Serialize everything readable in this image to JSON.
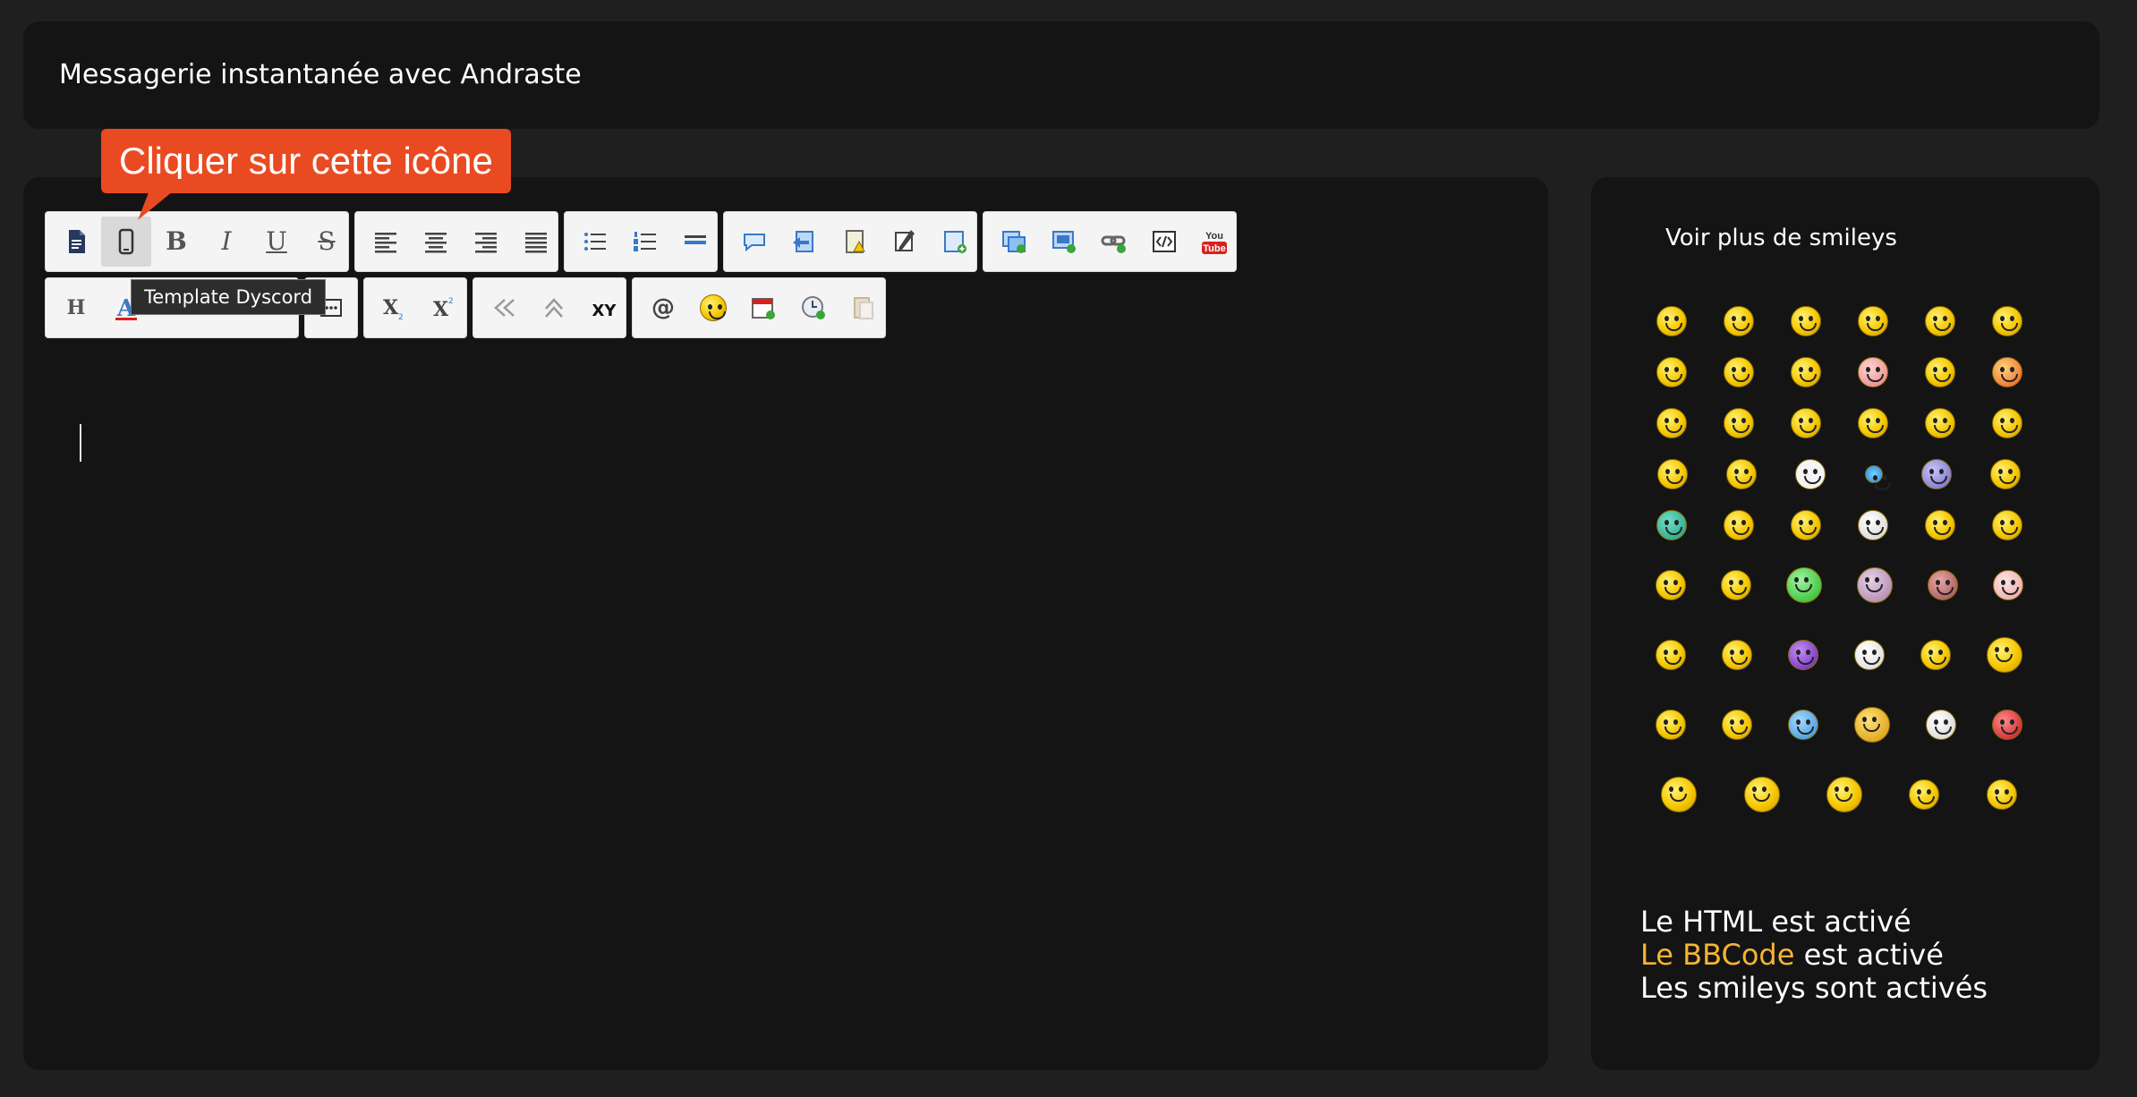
{
  "header": {
    "title": "Messagerie instantanée avec Andraste"
  },
  "callout": {
    "text": "Cliquer sur cette icône"
  },
  "tooltip": {
    "text": "Template Dyscord"
  },
  "toolbar": {
    "row1": [
      [
        "document-icon",
        "template-dyscord-icon",
        "bold-icon",
        "italic-icon",
        "underline-icon",
        "strikethrough-icon"
      ],
      [
        "align-left-icon",
        "align-center-icon",
        "align-right-icon",
        "align-justify-icon"
      ],
      [
        "bullet-list-icon",
        "numbered-list-icon",
        "horizontal-rule-icon"
      ],
      [
        "quote-icon",
        "spoiler-icon",
        "hide-icon",
        "edit-icon",
        "table-insert-icon"
      ],
      [
        "image-insert-icon",
        "image-host-icon",
        "link-icon",
        "code-icon",
        "youtube-icon"
      ]
    ],
    "row2": [
      [
        "heading-icon",
        "font-color-icon",
        "font-size-icon",
        "font-face-icon",
        "background-color-icon"
      ],
      [
        "more-icon"
      ],
      [
        "subscript-icon",
        "superscript-icon"
      ],
      [
        "flip-icon",
        "glow-icon",
        "reverse-icon"
      ],
      [
        "mention-icon",
        "smiley-icon",
        "date-insert-icon",
        "time-insert-icon",
        "paste-icon"
      ]
    ],
    "youtube": {
      "top": "You",
      "bottom": "Tube"
    },
    "glyphs": {
      "bold": "B",
      "italic": "I",
      "underline": "U",
      "strike": "S",
      "heading": "H",
      "sub": "X",
      "super": "X",
      "at": "@",
      "xy": "XY"
    }
  },
  "sidebar": {
    "more_smileys": "Voir plus de smileys",
    "smiley_rows": [
      6,
      6,
      6,
      6,
      6,
      6,
      6,
      6,
      5
    ]
  },
  "status": {
    "html": "Le HTML est activé",
    "bbcode_link": "Le BBCode",
    "bbcode_rest": " est activé",
    "smileys": "Les smileys sont activés"
  },
  "colors": {
    "accent": "#ea4a21",
    "highlight": "#f5b433",
    "card": "#141414",
    "background": "#1f1f1f"
  }
}
